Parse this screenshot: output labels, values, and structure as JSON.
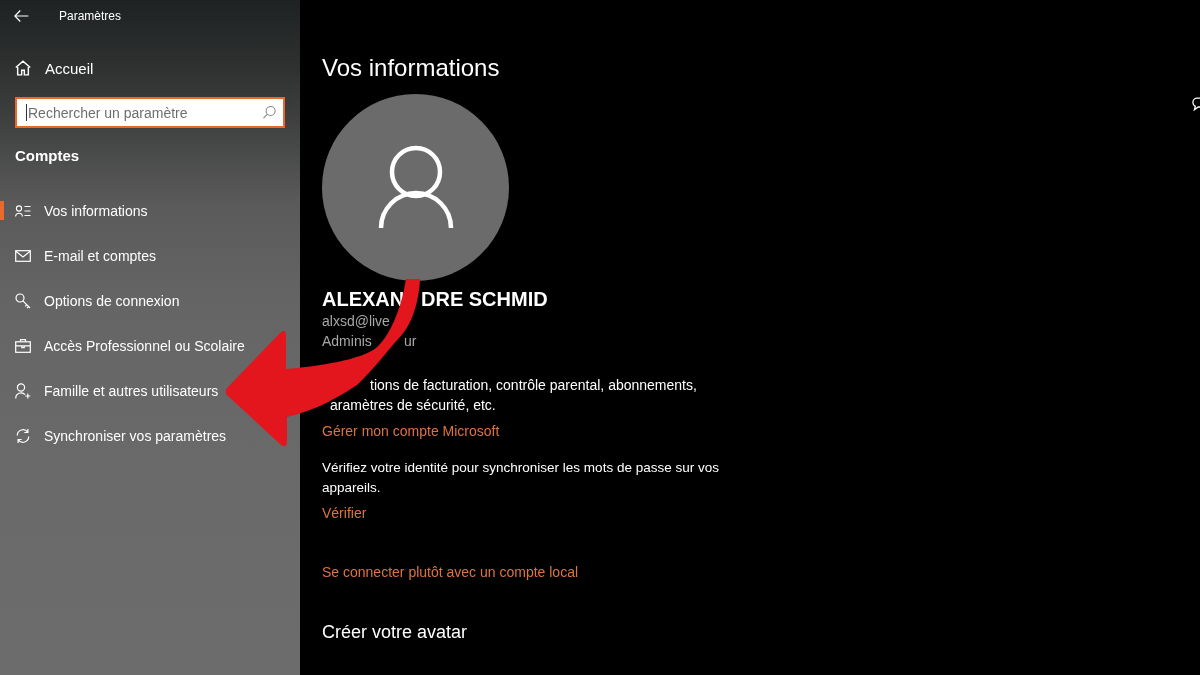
{
  "window": {
    "title": "Paramètres"
  },
  "sidebar": {
    "home": "Accueil",
    "search": {
      "placeholder": "Rechercher un paramètre"
    },
    "section": "Comptes",
    "items": [
      {
        "label": "Vos informations",
        "selected": true
      },
      {
        "label": "E-mail et comptes",
        "selected": false
      },
      {
        "label": "Options de connexion",
        "selected": false
      },
      {
        "label": "Accès Professionnel ou Scolaire",
        "selected": false
      },
      {
        "label": "Famille et autres utilisateurs",
        "selected": false
      },
      {
        "label": "Synchroniser vos paramètres",
        "selected": false
      }
    ]
  },
  "main": {
    "title": "Vos informations",
    "name_parts": [
      "ALEXAN",
      "DRE SCHMID"
    ],
    "email": "alxsd@live",
    "role_parts": [
      "Adminis",
      "ur"
    ],
    "description_lines": [
      "tions de facturation, contrôle parental, abonnements,",
      "aramètres de sécurité, etc."
    ],
    "manage_link": "Gérer mon compte Microsoft",
    "verify_text": "Vérifiez votre identité pour synchroniser les mots de passe sur vos appareils.",
    "verify_link": "Vérifier",
    "local_account_link": "Se connecter plutôt avec un compte local",
    "avatar_heading": "Créer votre avatar"
  }
}
